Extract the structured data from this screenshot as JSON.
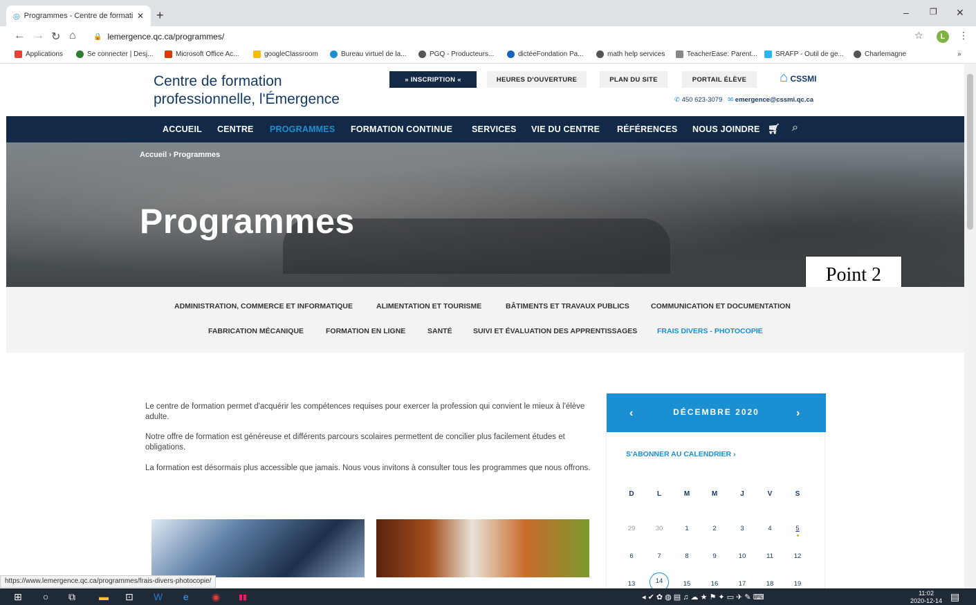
{
  "browser": {
    "tab_title": "Programmes - Centre de formati",
    "url": "lemergence.qc.ca/programmes/",
    "bookmarks": [
      "Applications",
      "Se connecter | Desj...",
      "Microsoft Office Ac...",
      "googleClassroom",
      "Bureau virtuel de la...",
      "PGQ - Producteurs...",
      "dictéeFondation Pa...",
      "math help services",
      "TeacherEase: Parent...",
      "SRAFP - Outil de ge...",
      "Charlemagne"
    ],
    "status_url": "https://www.lemergence.qc.ca/programmes/frais-divers-photocopie/",
    "profile_initial": "L"
  },
  "site": {
    "brand_line1": "Centre de formation",
    "brand_line2": "professionnelle, l'Émergence",
    "top_buttons": [
      "» INSCRIPTION «",
      "HEURES D'OUVERTURE",
      "PLAN DU SITE",
      "PORTAIL ÉLÈVE"
    ],
    "phone": "450 623-3079",
    "email": "emergence@cssmi.qc.ca",
    "logo_text": "CSSMI",
    "nav": [
      "ACCUEIL",
      "CENTRE",
      "PROGRAMMES",
      "FORMATION CONTINUE",
      "SERVICES",
      "VIE DU CENTRE",
      "RÉFÉRENCES",
      "NOUS JOINDRE"
    ],
    "breadcrumb": "Accueil › Programmes",
    "hero_title": "Programmes",
    "callout": "Point 2",
    "categories_row1": [
      "ADMINISTRATION, COMMERCE ET INFORMATIQUE",
      "ALIMENTATION ET TOURISME",
      "BÂTIMENTS ET TRAVAUX PUBLICS",
      "COMMUNICATION ET DOCUMENTATION"
    ],
    "categories_row2": [
      "FABRICATION MÉCANIQUE",
      "FORMATION EN LIGNE",
      "SANTÉ",
      "SUIVI ET ÉVALUATION DES APPRENTISSAGES",
      "FRAIS DIVERS - PHOTOCOPIE"
    ],
    "intro": [
      "Le centre de formation permet d'acquérir les compétences requises pour exercer la profession qui convient le mieux à l'élève adulte.",
      "Notre offre de formation est généreuse et différents parcours scolaires permettent de concilier plus facilement études et obligations.",
      "La formation est désormais plus accessible que jamais. Nous vous invitons à consulter tous les programmes que nous offrons."
    ],
    "calendar": {
      "month": "DÉCEMBRE 2020",
      "subscribe": "S'ABONNER AU CALENDRIER ›",
      "days_of_week": [
        "D",
        "L",
        "M",
        "M",
        "J",
        "V",
        "S"
      ],
      "weeks": [
        [
          "29",
          "30",
          "1",
          "2",
          "3",
          "4",
          "5"
        ],
        [
          "6",
          "7",
          "8",
          "9",
          "10",
          "11",
          "12"
        ],
        [
          "13",
          "14",
          "15",
          "16",
          "17",
          "18",
          "19"
        ]
      ]
    }
  },
  "taskbar": {
    "time": "11:02",
    "date": "2020-12-14"
  },
  "colors": {
    "nav_bg": "#122a48",
    "accent": "#1a8fd1",
    "brand": "#173a64"
  }
}
